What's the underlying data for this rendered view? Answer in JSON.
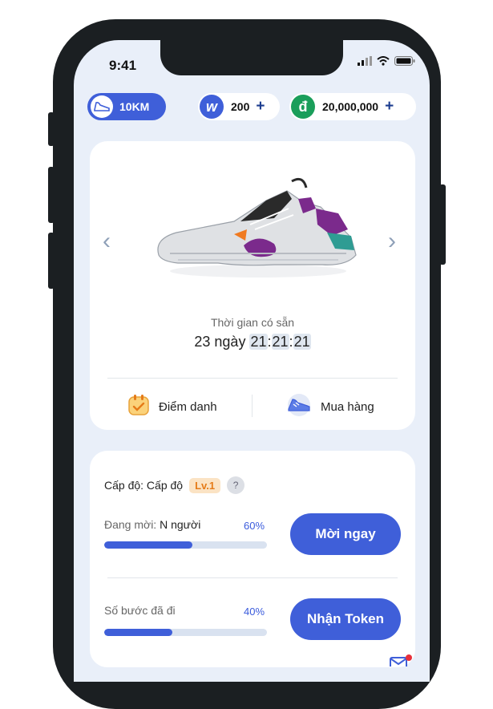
{
  "status_bar": {
    "time": "9:41"
  },
  "header": {
    "distance_label": "10KM",
    "token_w_value": "200",
    "token_d_value": "20,000,000",
    "plus_symbol": "+",
    "token_w_letter": "w",
    "token_d_letter": "đ"
  },
  "shoe_card": {
    "available_label": "Thời gian có sẵn",
    "days": "23 ngày",
    "hours": "21",
    "minutes": "21",
    "seconds": "21",
    "separator": ":",
    "actions": [
      {
        "label": "Điểm danh",
        "icon": "calendar-check-icon"
      },
      {
        "label": "Mua hàng",
        "icon": "shoe-icon"
      }
    ],
    "shoe_colors": {
      "body": "#dfe1e4",
      "accent": "#7b2a8c",
      "teal": "#2f9c93",
      "dark": "#2a2a2a",
      "orange": "#f07a20"
    }
  },
  "level_card": {
    "level_label": "Cấp độ: Cấp độ",
    "level_badge": "Lv.1",
    "help_symbol": "?",
    "tasks": [
      {
        "label": "Đang mời:",
        "value": "N người",
        "percent_text": "60%",
        "progress": 0.54,
        "button": "Mời ngay"
      },
      {
        "label": "Số bước đã đi",
        "value": "",
        "percent_text": "40%",
        "progress": 0.42,
        "button": "Nhận Token"
      }
    ]
  },
  "colors": {
    "primary": "#3f5fd9",
    "background": "#e9eff9",
    "badge": "#e57b18"
  }
}
